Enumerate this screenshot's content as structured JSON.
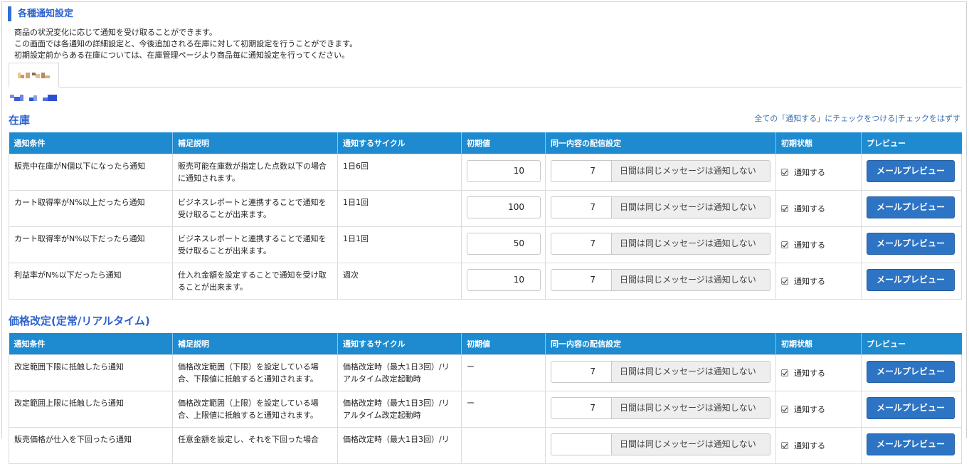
{
  "page": {
    "title": "各種通知設定",
    "intro": [
      "商品の状況変化に応じて通知を受け取ることができます。",
      "この画面では各通知の詳細設定と、今後追加される在庫に対して初期設定を行うことができます。",
      "初期設定前からある在庫については、在庫管理ページより商品毎に通知設定を行ってください。"
    ]
  },
  "colors": {
    "accent": "#2c62cf",
    "header_bg": "#1e8bd0",
    "button_bg": "#2d74c4"
  },
  "bulk_actions": {
    "check_all": "全ての「通知する」にチェックをつける",
    "separator": "|",
    "uncheck_all": "チェックをはずす"
  },
  "columns": [
    "通知条件",
    "補足説明",
    "通知するサイクル",
    "初期値",
    "同一内容の配信設定",
    "初期状態",
    "プレビュー"
  ],
  "suppress_suffix": "日間は同じメッセージは通知しない",
  "notify_label": "通知する",
  "preview_label": "メールプレビュー",
  "sections": [
    {
      "title": "在庫",
      "rows": [
        {
          "condition": "販売中在庫がN個以下になったら通知",
          "description": "販売可能在庫数が指定した点数以下の場合に通知されます。",
          "cycle": "1日6回",
          "initial": "10",
          "days": "7",
          "checked": true
        },
        {
          "condition": "カート取得率がN%以上だったら通知",
          "description": "ビジネスレポートと連携することで通知を受け取ることが出来ます。",
          "cycle": "1日1回",
          "initial": "100",
          "days": "7",
          "checked": true
        },
        {
          "condition": "カート取得率がN%以下だったら通知",
          "description": "ビジネスレポートと連携することで通知を受け取ることが出来ます。",
          "cycle": "1日1回",
          "initial": "50",
          "days": "7",
          "checked": true
        },
        {
          "condition": "利益率がN%以下だったら通知",
          "description": "仕入れ金額を設定することで通知を受け取ることが出来ます。",
          "cycle": "週次",
          "initial": "10",
          "days": "7",
          "checked": true
        }
      ]
    },
    {
      "title": "価格改定(定常/リアルタイム)",
      "rows": [
        {
          "condition": "改定範囲下限に抵触したら通知",
          "description": "価格改定範囲（下限）を設定している場合、下限値に抵触すると通知されます。",
          "cycle": "価格改定時（最大1日3回）/リアルタイム改定起動時",
          "initial": "ー",
          "days": "7",
          "checked": true
        },
        {
          "condition": "改定範囲上限に抵触したら通知",
          "description": "価格改定範囲（上限）を設定している場合、上限値に抵触すると通知されます。",
          "cycle": "価格改定時（最大1日3回）/リアルタイム改定起動時",
          "initial": "ー",
          "days": "7",
          "checked": true
        },
        {
          "condition": "販売価格が仕入を下回ったら通知",
          "description": "任意金額を設定し、それを下回った場合",
          "cycle": "価格改定時（最大1日3回）/リ",
          "initial": "",
          "days": "",
          "checked": true
        }
      ]
    }
  ]
}
